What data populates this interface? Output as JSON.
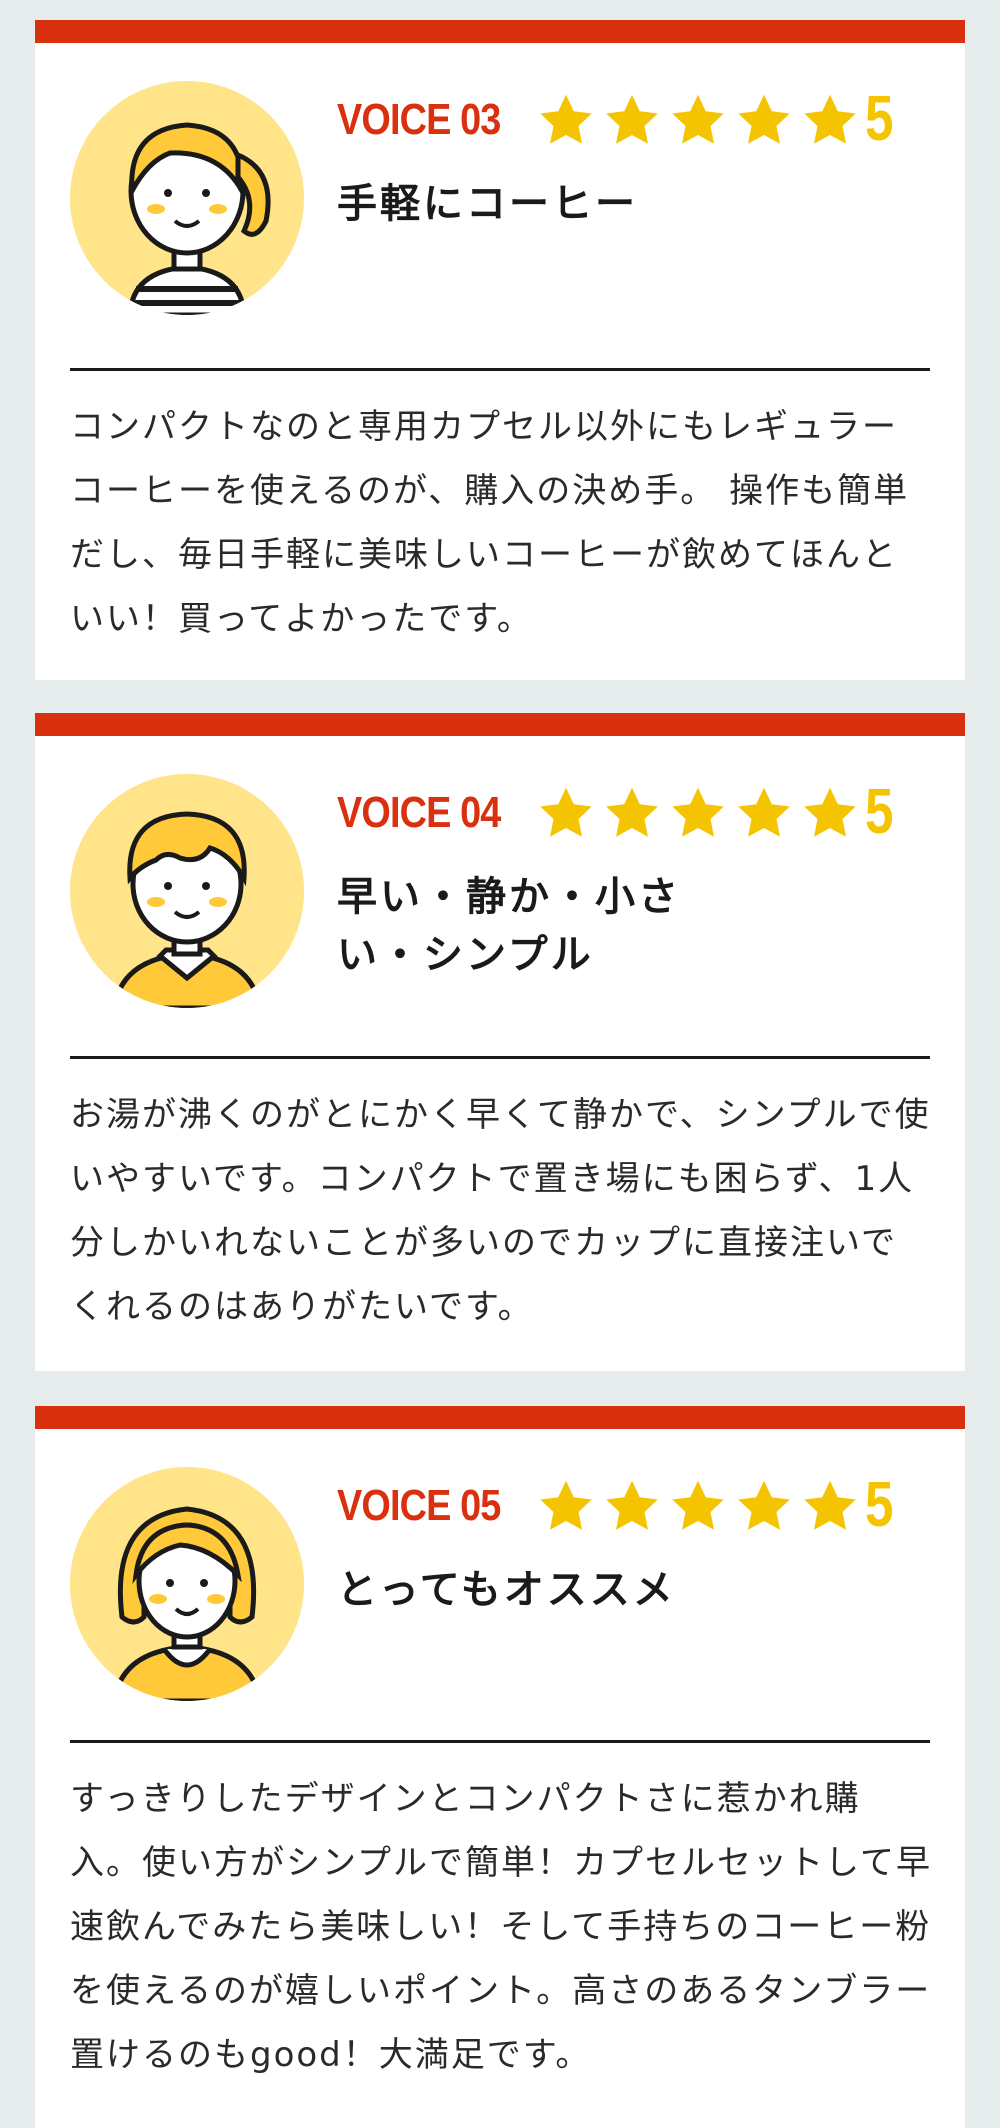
{
  "colors": {
    "accent": "#d9300f",
    "star": "#f5c400",
    "avatar_bg": "#ffe48a"
  },
  "reviews": [
    {
      "voice": "VOICE 03",
      "rating": "5",
      "title": "手軽にコーヒー",
      "avatar_icon": "woman-ponytail-avatar-icon",
      "body": "コンパクトなのと専用カプセル以外にもレギュラーコーヒーを使えるのが、購入の決め手。 操作も簡単だし、毎日手軽に美味しいコーヒーが飲めてほんといい！買ってよかったです。"
    },
    {
      "voice": "VOICE 04",
      "rating": "5",
      "title": "早い・静か・小さい・シンプル",
      "avatar_icon": "man-avatar-icon",
      "body": "お湯が沸くのがとにかく早くて静かで、シンプルで使いやすいです。コンパクトで置き場にも困らず、1人分しかいれないことが多いのでカップに直接注いでくれるのはありがたいです。"
    },
    {
      "voice": "VOICE 05",
      "rating": "5",
      "title": "とってもオススメ",
      "avatar_icon": "woman-bob-avatar-icon",
      "body": "すっきりしたデザインとコンパクトさに惹かれ購入。使い方がシンプルで簡単！カプセルセットして早速飲んでみたら美味しい！そして手持ちのコーヒー粉を使えるのが嬉しいポイント。高さのあるタンブラー置けるのもgood！大満足です。"
    }
  ]
}
